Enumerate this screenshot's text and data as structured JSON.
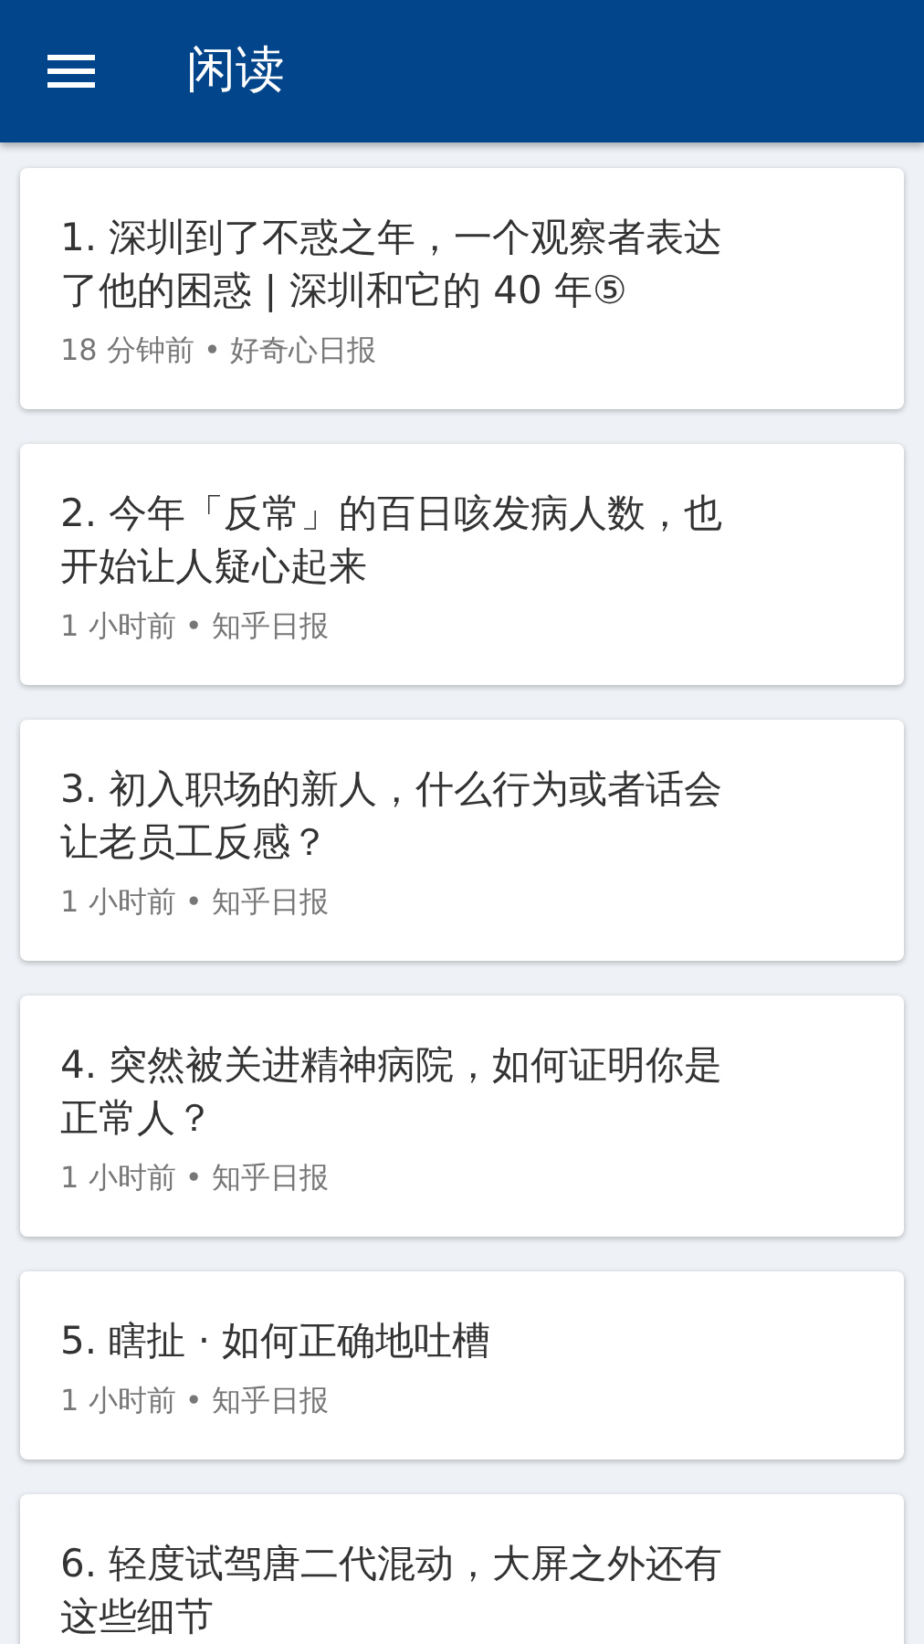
{
  "app_bar": {
    "title": "闲读"
  },
  "articles": [
    {
      "title": "1. 深圳到了不惑之年，一个观察者表达了他的困惑 | 深圳和它的 40 年⑤",
      "meta": "18 分钟前 • 好奇心日报"
    },
    {
      "title": "2. 今年「反常」的百日咳发病人数，也开始让人疑心起来",
      "meta": "1 小时前 • 知乎日报"
    },
    {
      "title": "3. 初入职场的新人，什么行为或者话会让老员工反感？",
      "meta": "1 小时前 • 知乎日报"
    },
    {
      "title": "4. 突然被关进精神病院，如何证明你是正常人？",
      "meta": "1 小时前 • 知乎日报"
    },
    {
      "title": "5. 瞎扯 · 如何正确地吐槽",
      "meta": "1 小时前 • 知乎日报"
    },
    {
      "title": "6. 轻度试驾唐二代混动，大屏之外还有这些细节"
    }
  ]
}
